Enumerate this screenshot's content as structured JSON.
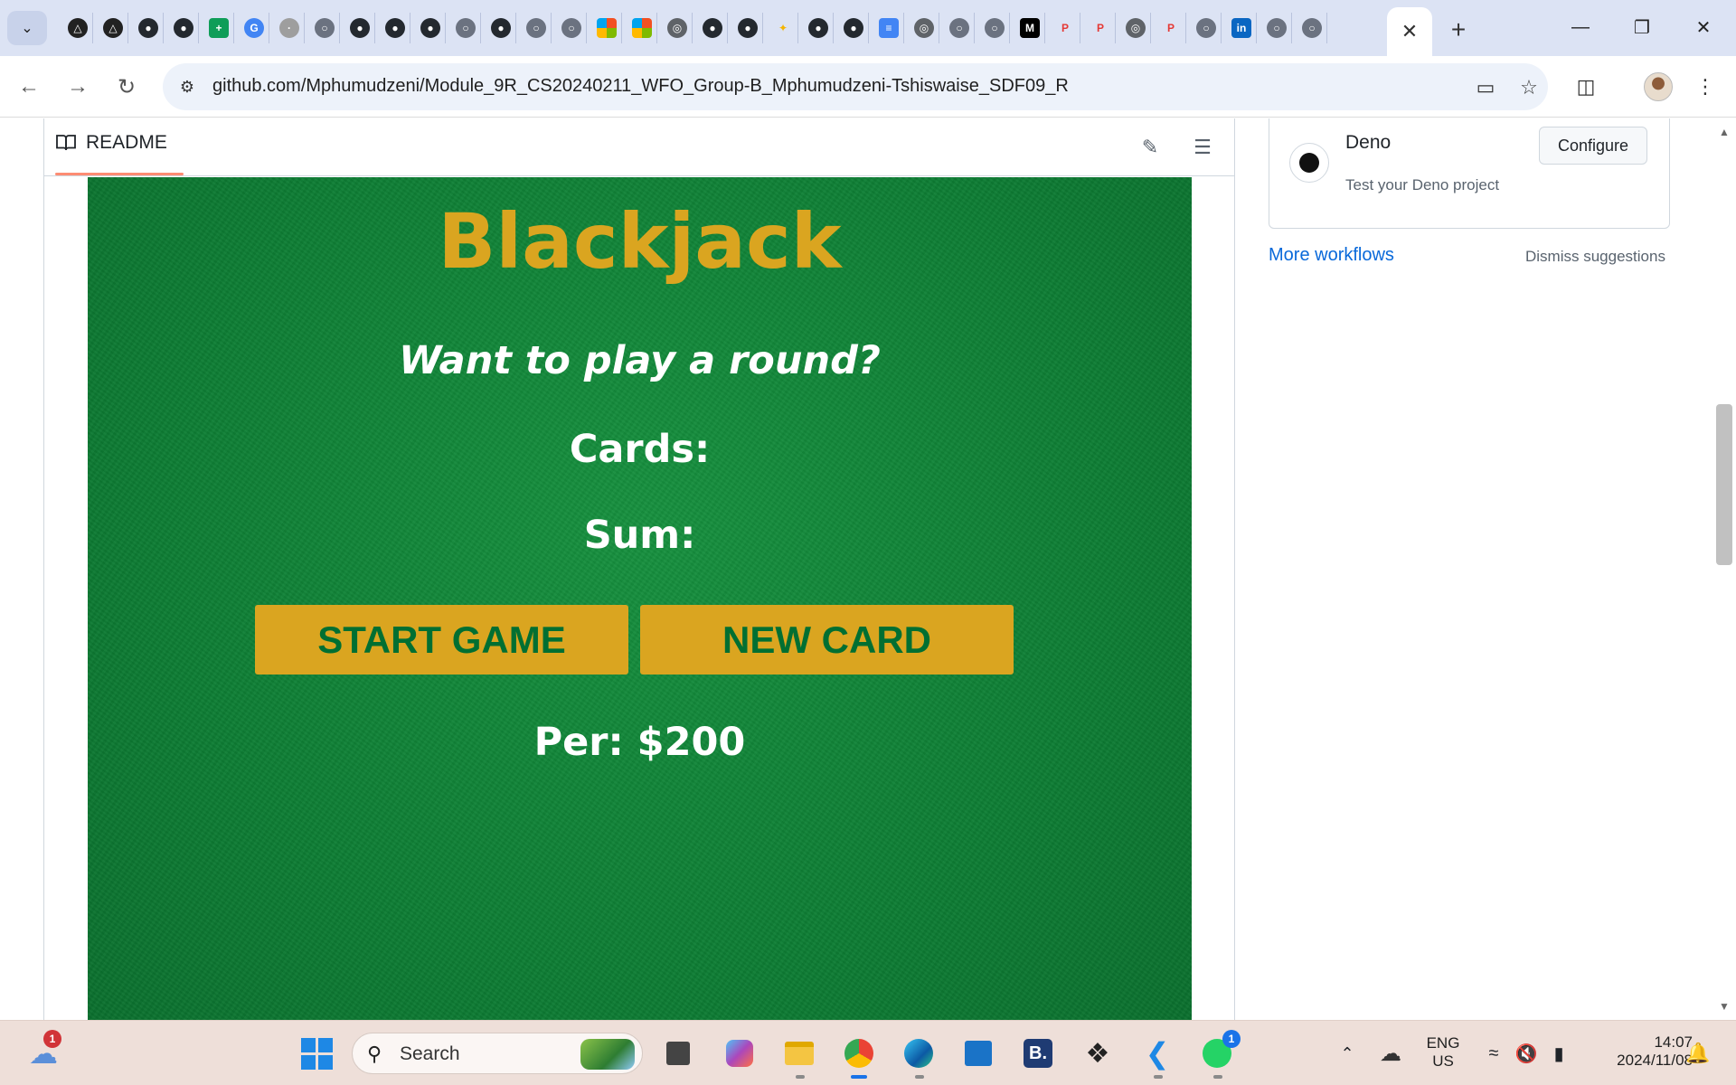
{
  "browser": {
    "url": "github.com/Mphumudzeni/Module_9R_CS20240211_WFO_Group-B_Mphumudzeni-Tshiswaise_SDF09_R",
    "tab_icons": [
      "A",
      "A",
      "github",
      "github",
      "plus",
      "G",
      "sx",
      "globe",
      "github",
      "github",
      "github",
      "globe",
      "github",
      "globe",
      "globe",
      "ms",
      "ms",
      "chrome",
      "github",
      "github",
      "star",
      "github",
      "github",
      "docs",
      "chrome",
      "globe",
      "globe",
      "M",
      "P",
      "P",
      "chrome",
      "P",
      "globe",
      "in",
      "globe",
      "globe"
    ],
    "new_tab_label": "+",
    "close_tab_label": "✕"
  },
  "readme": {
    "tab_label": "README"
  },
  "game": {
    "title": "Blackjack",
    "message": "Want to play a round?",
    "cards_label": "Cards:",
    "sum_label": "Sum:",
    "start_button": "START GAME",
    "new_card_button": "NEW CARD",
    "player_info": "Per: $200",
    "colors": {
      "felt": "#0d7e34",
      "accent": "#daa520",
      "button_text": "#016f32"
    }
  },
  "sidebar": {
    "workflow_name": "Deno",
    "workflow_desc": "Test your Deno project",
    "configure_label": "Configure",
    "more_workflows": "More workflows",
    "dismiss": "Dismiss suggestions"
  },
  "taskbar": {
    "weather_badge": "1",
    "search_placeholder": "Search",
    "whatsapp_badge": "1",
    "lang_line1": "ENG",
    "lang_line2": "US",
    "time": "14:07",
    "date": "2024/11/08"
  }
}
